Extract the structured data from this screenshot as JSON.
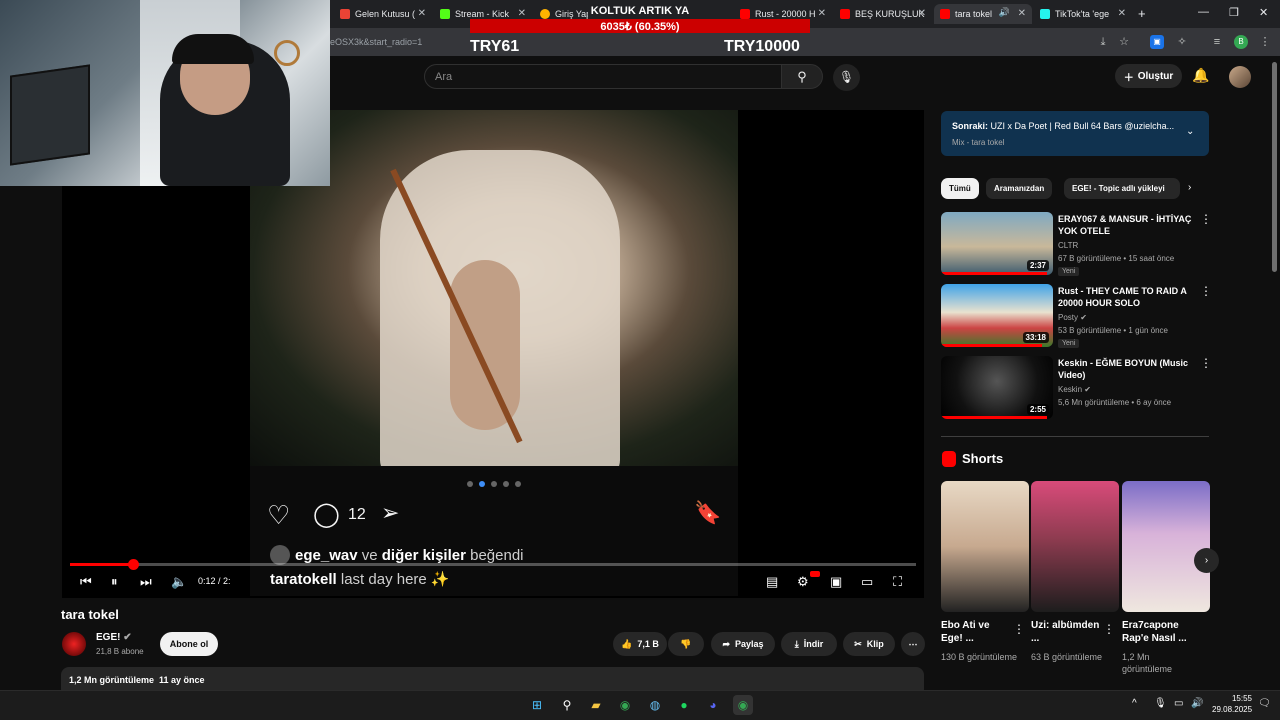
{
  "browser": {
    "tabs": [
      {
        "title": "Gelen Kutusu (",
        "color": "#ea4335"
      },
      {
        "title": "Stream - Kick",
        "color": "#53fc18"
      },
      {
        "title": "Giriş Yap",
        "color": "#ffb300"
      },
      {
        "title": "Rust - 20000 H",
        "color": "#ff0000"
      },
      {
        "title": "BEŞ KURUŞLUK",
        "color": "#ff0000"
      },
      {
        "title": "tara tokel",
        "color": "#ff0000"
      },
      {
        "title": "TikTok'ta 'ege",
        "color": "#25f4ee"
      }
    ],
    "url_fragment": "eOSX3k&start_radio=1"
  },
  "stream_overlay": {
    "title": "KOLTUK ARTIK YA",
    "progress": "6035₺ (60.35%)",
    "progress_fraction": 0.6035,
    "left_label": "TRY61",
    "right_label": "TRY10000"
  },
  "header": {
    "search_placeholder": "Ara",
    "create_label": "Oluştur"
  },
  "player": {
    "ig_comment_count": "12",
    "ig_liked_user": "ege_wav",
    "ig_liked_join": "ve",
    "ig_liked_others": "diğer kişiler",
    "ig_liked_suffix": "beğendi",
    "ig_caption_user": "taratokell",
    "ig_caption_text": "last day here ✨",
    "carousel_dots": 5,
    "carousel_active": 1,
    "time": "0:12 / 2:",
    "progress_fraction": 0.075
  },
  "video": {
    "title": "tara tokel",
    "channel": "EGE!",
    "subscribers": "21,8 B abone",
    "subscribe_label": "Abone ol",
    "likes": "7,1 B",
    "share_label": "Paylaş",
    "download_label": "İndir",
    "clip_label": "Klip",
    "views": "1,2 Mn görüntüleme",
    "age": "11 ay önce"
  },
  "sidebar": {
    "next_label": "Sonraki:",
    "next_title": "UZI x Da Poet | Red Bull 64 Bars @uzielcha...",
    "next_sub": "Mix - tara tokel",
    "chips": [
      "Tümü",
      "Aramanızdan",
      "EGE! - Topic adlı yükleyi"
    ],
    "videos": [
      {
        "title": "ERAY067 & MANSUR - İHTİYAÇ YOK OTELE",
        "channel": "CLTR",
        "meta": "67 B görüntüleme • 15 saat önce",
        "new": "Yeni",
        "duration": "2:37",
        "watched": 0.95
      },
      {
        "title": "Rust - THEY CAME TO RAID A 20000 HOUR SOLO",
        "channel": "Posty",
        "meta": "53 B görüntüleme • 1 gün önce",
        "new": "Yeni",
        "duration": "33:18",
        "watched": 0.9
      },
      {
        "title": "Keskin - EĞME BOYUN (Music Video)",
        "channel": "Keskin",
        "meta": "5,6 Mn görüntüleme • 6 ay önce",
        "new": "",
        "duration": "2:55",
        "watched": 0.95
      }
    ],
    "shorts_title": "Shorts",
    "shorts": [
      {
        "title": "Ebo Ati ve Ege! ...",
        "views": "130 B görüntüleme"
      },
      {
        "title": "Uzi: albümden ...",
        "views": "63 B görüntüleme"
      },
      {
        "title": "Era7capone Rap'e Nasıl ...",
        "views": "1,2 Mn görüntüleme"
      }
    ]
  },
  "taskbar": {
    "time": "15:55",
    "date": "29.08.2025"
  }
}
